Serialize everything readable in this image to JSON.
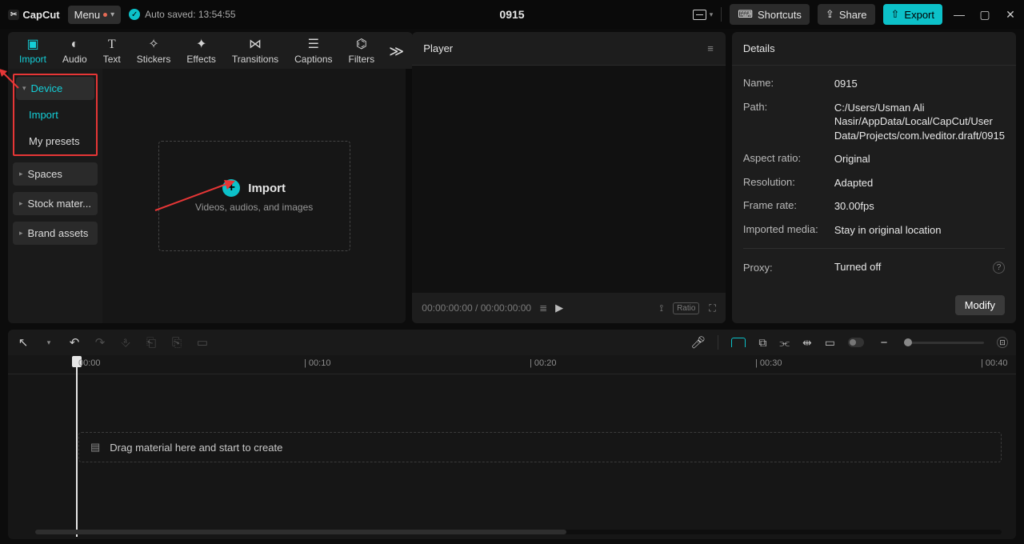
{
  "app": {
    "name": "CapCut"
  },
  "menu_label": "Menu",
  "autosave_label": "Auto saved: 13:54:55",
  "project_title": "0915",
  "header": {
    "shortcuts": "Shortcuts",
    "share": "Share",
    "export": "Export"
  },
  "toptabs": {
    "import": "Import",
    "audio": "Audio",
    "text": "Text",
    "stickers": "Stickers",
    "effects": "Effects",
    "transitions": "Transitions",
    "captions": "Captions",
    "filters": "Filters"
  },
  "media_side": {
    "device": "Device",
    "import": "Import",
    "my_presets": "My presets",
    "spaces": "Spaces",
    "stock": "Stock mater...",
    "brand": "Brand assets"
  },
  "import_box": {
    "title": "Import",
    "subtitle": "Videos, audios, and images"
  },
  "player": {
    "title": "Player",
    "time_current": "00:00:00:00",
    "time_total": "00:00:00:00",
    "ratio_badge": "Ratio"
  },
  "details": {
    "title": "Details",
    "labels": {
      "name": "Name:",
      "path": "Path:",
      "aspect": "Aspect ratio:",
      "resolution": "Resolution:",
      "framerate": "Frame rate:",
      "imported": "Imported media:",
      "proxy": "Proxy:"
    },
    "values": {
      "name": "0915",
      "path": "C:/Users/Usman Ali Nasir/AppData/Local/CapCut/User Data/Projects/com.lveditor.draft/0915",
      "aspect": "Original",
      "resolution": "Adapted",
      "framerate": "30.00fps",
      "imported": "Stay in original location",
      "proxy": "Turned off"
    },
    "modify": "Modify"
  },
  "timeline": {
    "drop_hint": "Drag material here and start to create",
    "ticks": [
      "00:00",
      "00:10",
      "00:20",
      "00:30",
      "00:40"
    ]
  }
}
